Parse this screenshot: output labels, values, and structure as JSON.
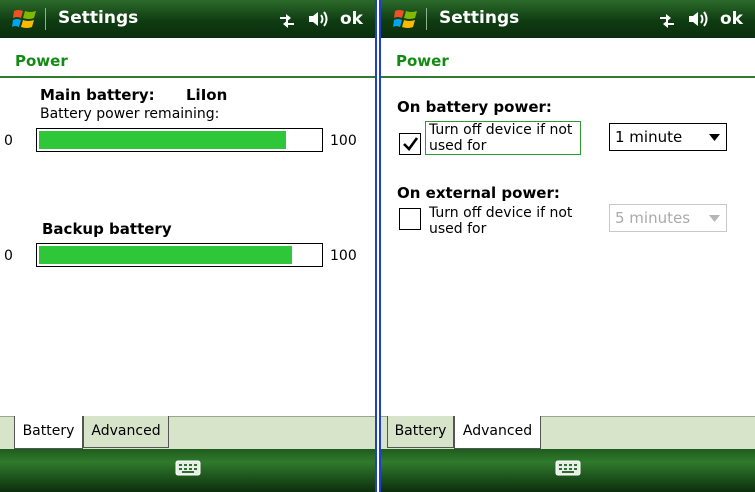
{
  "screens": [
    {
      "title": "Settings",
      "ok_label": "ok",
      "header": "Power",
      "main_battery_label": "Main battery:",
      "main_battery_type": "LiIon",
      "remaining_label": "Battery power remaining:",
      "main_bar": {
        "min": "0",
        "max": "100",
        "value": 88
      },
      "backup_label": "Backup battery",
      "backup_bar": {
        "min": "0",
        "max": "100",
        "value": 90
      },
      "tabs": [
        {
          "label": "Battery",
          "active": true
        },
        {
          "label": "Advanced",
          "active": false
        }
      ]
    },
    {
      "title": "Settings",
      "ok_label": "ok",
      "header": "Power",
      "battery_section": "On battery power:",
      "battery_option": {
        "label": "Turn off device if not used for",
        "checked": true,
        "value": "1 minute",
        "enabled": true
      },
      "external_section": "On external power:",
      "external_option": {
        "label": "Turn off device if not used for",
        "checked": false,
        "value": "5 minutes",
        "enabled": false
      },
      "tabs": [
        {
          "label": "Battery",
          "active": false
        },
        {
          "label": "Advanced",
          "active": true
        }
      ]
    }
  ],
  "icons": {
    "logo": "windows-logo-icon",
    "connectivity": "connectivity-icon",
    "volume": "speaker-icon",
    "keyboard": "keyboard-icon"
  },
  "colors": {
    "titlebar": "#184f18",
    "accent_green": "#138a13",
    "progress_fill": "#2ec73a",
    "separator_blue": "#1f3fd0",
    "tab_bg": "#d7e4c9"
  }
}
